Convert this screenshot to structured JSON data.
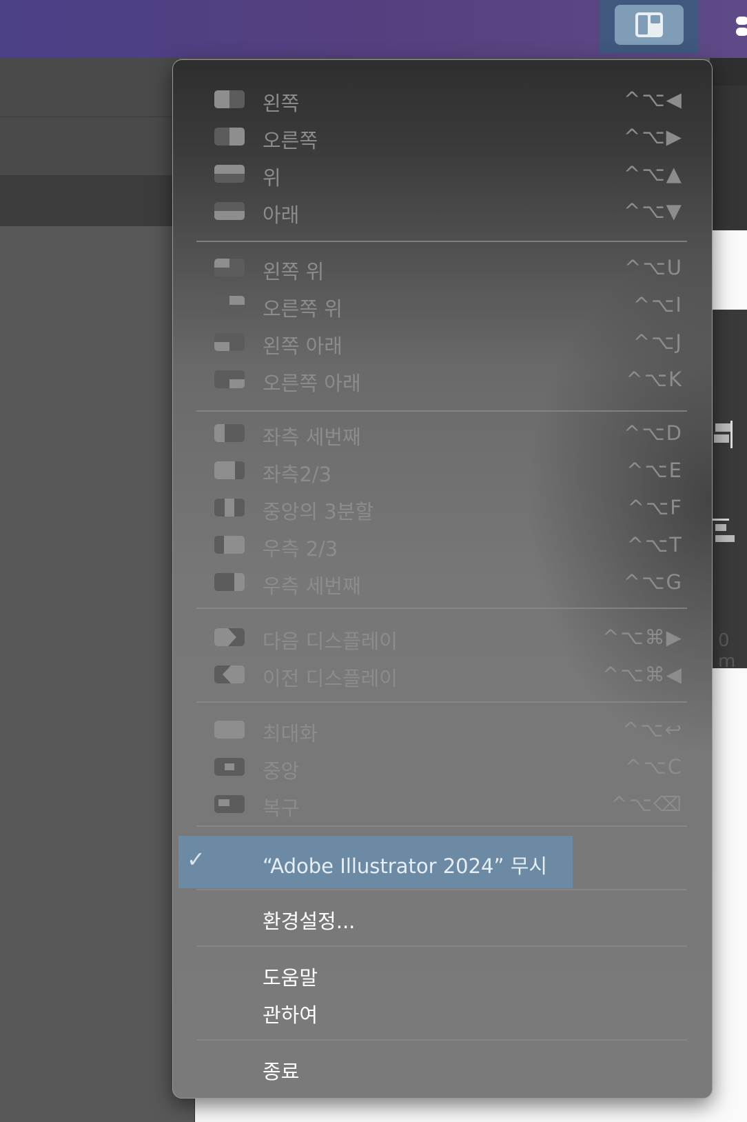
{
  "menu": {
    "position_items": [
      {
        "label": "왼쪽",
        "shortcut": "^⌥◀"
      },
      {
        "label": "오른쪽",
        "shortcut": "^⌥▶"
      },
      {
        "label": "위",
        "shortcut": "^⌥▲"
      },
      {
        "label": "아래",
        "shortcut": "^⌥▼"
      }
    ],
    "corner_items": [
      {
        "label": "왼쪽 위",
        "shortcut": "^⌥U"
      },
      {
        "label": "오른쪽 위",
        "shortcut": "^⌥I"
      },
      {
        "label": "왼쪽 아래",
        "shortcut": "^⌥J"
      },
      {
        "label": "오른쪽 아래",
        "shortcut": "^⌥K"
      }
    ],
    "third_items": [
      {
        "label": "좌측 세번째",
        "shortcut": "^⌥D"
      },
      {
        "label": "좌측2/3",
        "shortcut": "^⌥E"
      },
      {
        "label": "중앙의 3분할",
        "shortcut": "^⌥F"
      },
      {
        "label": "우측 2/3",
        "shortcut": "^⌥T"
      },
      {
        "label": "우측 세번째",
        "shortcut": "^⌥G"
      }
    ],
    "display_items": [
      {
        "label": "다음 디스플레이",
        "shortcut": "^⌥⌘▶"
      },
      {
        "label": "이전 디스플레이",
        "shortcut": "^⌥⌘◀"
      }
    ],
    "size_items": [
      {
        "label": "최대화",
        "shortcut": "^⌥↩"
      },
      {
        "label": "중앙",
        "shortcut": "^⌥C"
      },
      {
        "label": "복구",
        "shortcut": "^⌥⌫"
      }
    ],
    "ignore_app": {
      "label": "“Adobe Illustrator 2024” 무시",
      "checked": true,
      "check_glyph": "✓"
    },
    "preferences": {
      "label": "환경설정..."
    },
    "help": {
      "label": "도움말"
    },
    "about": {
      "label": "관하여"
    },
    "quit": {
      "label": "종료"
    }
  },
  "background": {
    "right_partial_text": "0 m"
  },
  "colors": {
    "menubar_gradient_start": "#4b3f86",
    "menu_highlight": "#6c8aa4",
    "disabled_text": "#8c8c8c",
    "enabled_text": "#ffffff"
  }
}
